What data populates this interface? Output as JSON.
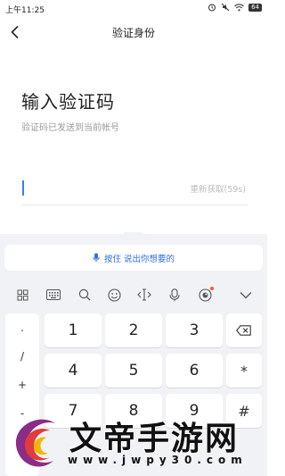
{
  "status_bar": {
    "time": "上午11:25",
    "battery": "64"
  },
  "header": {
    "title": "验证身份",
    "back_icon": "chevron-left-icon"
  },
  "main": {
    "heading": "输入验证码",
    "subtitle": "验证码已发送到当前帐号",
    "code_input": {
      "value": "",
      "placeholder": ""
    },
    "resend_label": "重新获取(59s)"
  },
  "keyboard": {
    "voice_bar_label": "按住 说出你想要的",
    "toolbar_icons": [
      "grid-icon",
      "keyboard-icon",
      "search-icon",
      "emoji-icon",
      "cursor-icon",
      "microphone-icon",
      "sticker-icon",
      "chevron-down-icon"
    ],
    "symbols": [
      ".",
      "/",
      "+",
      "-"
    ],
    "digits": [
      "1",
      "2",
      "3",
      "4",
      "5",
      "6",
      "7",
      "8",
      "9"
    ],
    "side_keys": [
      "⌫",
      "*",
      "#"
    ]
  },
  "watermark": {
    "text": "文帝手游网",
    "url": "www.jwpy30.com"
  },
  "colors": {
    "accent": "#2f6fe4",
    "caret": "#3a7bff",
    "keyboard_bg": "#f1f2f5",
    "hint_text": "#9a9a9a"
  }
}
